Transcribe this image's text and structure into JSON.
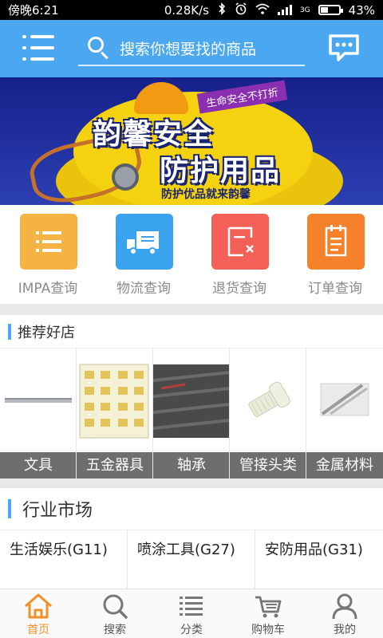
{
  "status_bar": {
    "time": "傍晚6:21",
    "network_speed": "0.28K/s",
    "signal_label": "3G",
    "battery_percent": "43%",
    "battery_level": 0.43
  },
  "header": {
    "search_placeholder": "搜索你想要找的商品"
  },
  "banner": {
    "title_line1": "韵馨安全",
    "title_line2": "防护用品",
    "ribbon_text": "生命安全不打折",
    "slogan": "防护优品就来韵馨"
  },
  "quick_actions": [
    {
      "label": "IMPA查询",
      "color": "#f4b342"
    },
    {
      "label": "物流查询",
      "color": "#3aa3f0"
    },
    {
      "label": "退货查询",
      "color": "#f26058"
    },
    {
      "label": "订单查询",
      "color": "#f5822a"
    }
  ],
  "shops_section": {
    "title": "推荐好店",
    "items": [
      {
        "label": "文具"
      },
      {
        "label": "五金器具"
      },
      {
        "label": "轴承"
      },
      {
        "label": "管接头类"
      },
      {
        "label": "金属材料"
      }
    ]
  },
  "market_section": {
    "title": "行业市场",
    "items": [
      {
        "label": "生活娱乐(G11)"
      },
      {
        "label": "喷涂工具(G27)"
      },
      {
        "label": "安防用品(G31)"
      }
    ]
  },
  "bottom_nav": {
    "active_color": "#f0902a",
    "items": [
      {
        "label": "首页",
        "icon": "home-icon"
      },
      {
        "label": "搜索",
        "icon": "search-icon"
      },
      {
        "label": "分类",
        "icon": "category-icon"
      },
      {
        "label": "购物车",
        "icon": "cart-icon"
      },
      {
        "label": "我的",
        "icon": "user-icon"
      }
    ]
  }
}
